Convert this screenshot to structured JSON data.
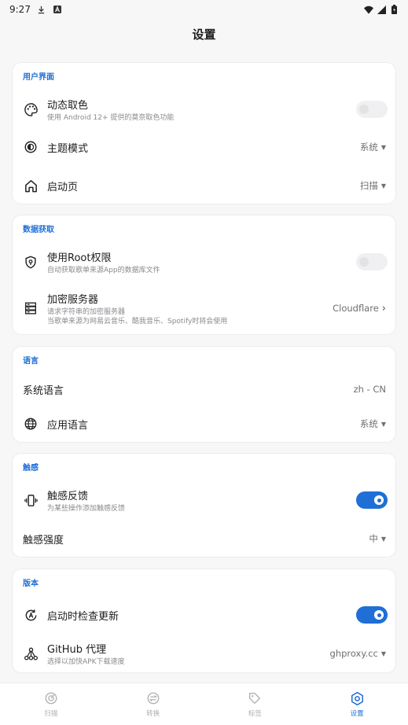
{
  "status_bar": {
    "time": "9:27",
    "icons": [
      "download-icon",
      "a-badge-icon",
      "wifi-icon",
      "signal-icon",
      "battery-icon"
    ]
  },
  "header": {
    "title": "设置"
  },
  "sections": {
    "ui": {
      "title": "用户界面",
      "dynamic_color": {
        "title": "动态取色",
        "subtitle": "使用 Android 12+ 提供的莫奈取色功能",
        "enabled": false
      },
      "theme_mode": {
        "title": "主题模式",
        "value": "系统"
      },
      "launch_page": {
        "title": "启动页",
        "value": "扫描"
      }
    },
    "data": {
      "title": "数据获取",
      "root": {
        "title": "使用Root权限",
        "subtitle": "自动获取歌单来源App的数据库文件",
        "enabled": false
      },
      "encrypt_server": {
        "title": "加密服务器",
        "subtitle1": "请求字符串的加密服务器",
        "subtitle2": "当歌单来源为网易云音乐、酷我音乐、Spotify时将会使用",
        "value": "Cloudflare"
      }
    },
    "language": {
      "title": "语言",
      "system_language": {
        "title": "系统语言",
        "value": "zh - CN"
      },
      "app_language": {
        "title": "应用语言",
        "value": "系统"
      }
    },
    "haptics": {
      "title": "触感",
      "feedback": {
        "title": "触感反馈",
        "subtitle": "为某些操作添加触感反馈",
        "enabled": true
      },
      "intensity": {
        "title": "触感强度",
        "value": "中"
      }
    },
    "version": {
      "title": "版本",
      "check_update": {
        "title": "启动时检查更新",
        "enabled": true
      },
      "github_proxy": {
        "title": "GitHub 代理",
        "subtitle": "选择以加快APK下载速度",
        "value": "ghproxy.cc"
      }
    }
  },
  "bottom_nav": {
    "items": [
      {
        "label": "扫描",
        "icon": "scan-icon"
      },
      {
        "label": "转换",
        "icon": "convert-icon"
      },
      {
        "label": "标签",
        "icon": "tag-icon"
      },
      {
        "label": "设置",
        "icon": "settings-icon",
        "active": true
      }
    ]
  },
  "colors": {
    "accent": "#1f6fd6",
    "background": "#f7f7f8",
    "card": "#ffffff"
  }
}
